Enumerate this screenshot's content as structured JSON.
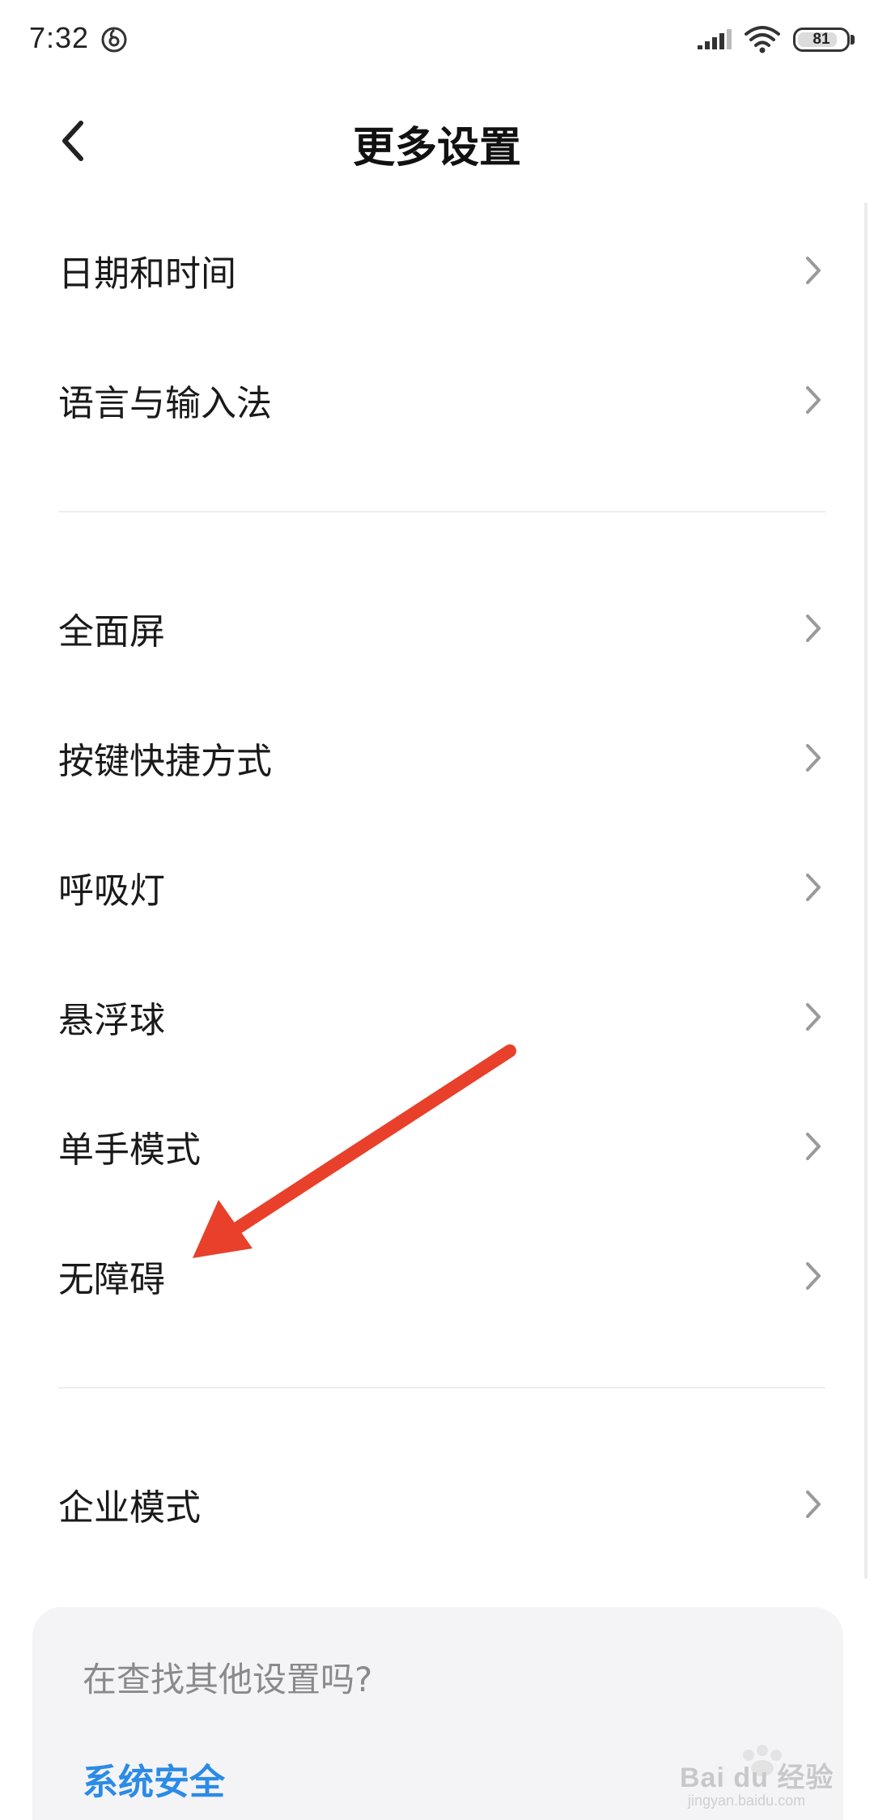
{
  "status_bar": {
    "time": "7:32",
    "battery_level": "81",
    "icons": [
      "netease-music-icon",
      "signal-icon",
      "wifi-icon",
      "battery-icon"
    ]
  },
  "header": {
    "title": "更多设置",
    "back_icon": "chevron-left-icon"
  },
  "groups": [
    {
      "items": [
        {
          "label": "日期和时间"
        },
        {
          "label": "语言与输入法"
        }
      ]
    },
    {
      "items": [
        {
          "label": "全面屏"
        },
        {
          "label": "按键快捷方式"
        },
        {
          "label": "呼吸灯"
        },
        {
          "label": "悬浮球"
        },
        {
          "label": "单手模式"
        },
        {
          "label": "无障碍"
        }
      ]
    },
    {
      "items": [
        {
          "label": "企业模式"
        }
      ]
    }
  ],
  "suggestion_card": {
    "title": "在查找其他设置吗?",
    "link": "系统安全"
  },
  "annotation": {
    "color": "#e8402a",
    "target": "无障碍"
  },
  "watermark": {
    "text": "Bai du 经验",
    "sub": "jingyan.baidu.com"
  },
  "colors": {
    "accent": "#2b8be6",
    "chevron": "#9a9a9a",
    "divider": "#ededed",
    "card_bg": "#f4f4f6"
  }
}
